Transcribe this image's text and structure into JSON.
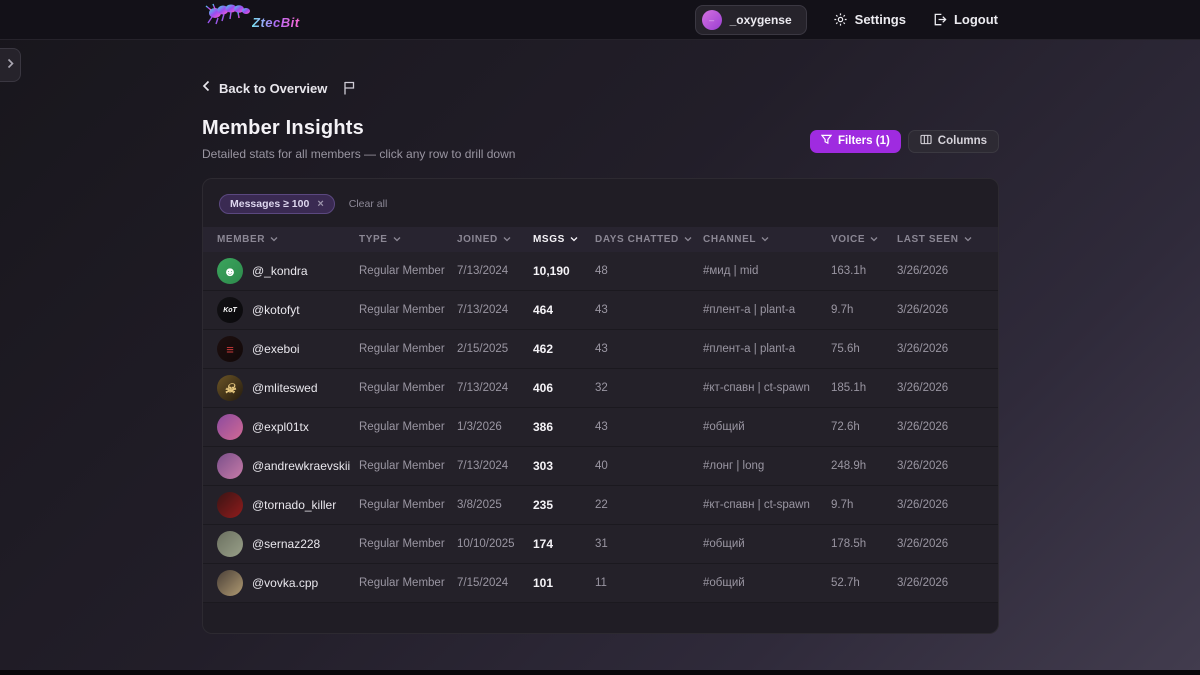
{
  "brand": {
    "name": "ZtecBit"
  },
  "topbar": {
    "username": "_oxygense",
    "user_avatar_mark": "–",
    "settings_label": "Settings",
    "logout_label": "Logout"
  },
  "page": {
    "back_label": "Back to Overview",
    "title": "Member Insights",
    "subtitle": "Detailed stats for all members — click any row to drill down",
    "filters_label": "Filters (1)",
    "columns_label": "Columns"
  },
  "filters": {
    "chip_label": "Messages ≥ 100",
    "chip_remove": "×",
    "clear_label": "Clear all"
  },
  "colors": {
    "accent_purple": "#9f2be0",
    "chip_bg": "#3a2a52",
    "card_bg": "#201d25",
    "topbar_bg": "#131118"
  },
  "table": {
    "columns": [
      {
        "label": "MEMBER",
        "active": false
      },
      {
        "label": "TYPE",
        "active": false
      },
      {
        "label": "JOINED",
        "active": false
      },
      {
        "label": "MSGS",
        "active": true
      },
      {
        "label": "DAYS CHATTED",
        "active": false
      },
      {
        "label": "CHANNEL",
        "active": false
      },
      {
        "label": "VOICE",
        "active": false
      },
      {
        "label": "LAST SEEN",
        "active": false
      }
    ],
    "rows": [
      {
        "member": "@_kondra",
        "type": "Regular Member",
        "joined": "7/13/2024",
        "msgs": "10,190",
        "days": "48",
        "channel": "#мид | mid",
        "voice": "163.1h",
        "last_seen": "3/26/2026",
        "avatar": {
          "glyph": "☻",
          "glyph_color": "#ffffff",
          "from": "#3ba55d",
          "to": "#2e8a4c"
        }
      },
      {
        "member": "@kotofyt",
        "type": "Regular Member",
        "joined": "7/13/2024",
        "msgs": "464",
        "days": "43",
        "channel": "#плент-а | plant-a",
        "voice": "9.7h",
        "last_seen": "3/26/2026",
        "avatar": {
          "glyph": "KoT",
          "glyph_color": "#ffffff",
          "from": "#121114",
          "to": "#0a090c"
        }
      },
      {
        "member": "@exeboi",
        "type": "Regular Member",
        "joined": "2/15/2025",
        "msgs": "462",
        "days": "43",
        "channel": "#плент-а | plant-a",
        "voice": "75.6h",
        "last_seen": "3/26/2026",
        "avatar": {
          "glyph": "≡",
          "glyph_color": "#c93a3a",
          "from": "#1d0f0f",
          "to": "#120909"
        }
      },
      {
        "member": "@mliteswed",
        "type": "Regular Member",
        "joined": "7/13/2024",
        "msgs": "406",
        "days": "32",
        "channel": "#кт-спавн | ct-spawn",
        "voice": "185.1h",
        "last_seen": "3/26/2026",
        "avatar": {
          "glyph": "☠",
          "glyph_color": "#e6c77e",
          "from": "#6b5426",
          "to": "#241b0e"
        }
      },
      {
        "member": "@expl01tx",
        "type": "Regular Member",
        "joined": "1/3/2026",
        "msgs": "386",
        "days": "43",
        "channel": "#общий",
        "voice": "72.6h",
        "last_seen": "3/26/2026",
        "avatar": {
          "glyph": "",
          "glyph_color": "#ffffff",
          "from": "#8b4a9e",
          "to": "#d16a95"
        }
      },
      {
        "member": "@andrewkraevskii",
        "type": "Regular Member",
        "joined": "7/13/2024",
        "msgs": "303",
        "days": "40",
        "channel": "#лонг | long",
        "voice": "248.9h",
        "last_seen": "3/26/2026",
        "avatar": {
          "glyph": "",
          "glyph_color": "#ffffff",
          "from": "#7a4f8a",
          "to": "#c77ba8"
        }
      },
      {
        "member": "@tornado_killer",
        "type": "Regular Member",
        "joined": "3/8/2025",
        "msgs": "235",
        "days": "22",
        "channel": "#кт-спавн | ct-spawn",
        "voice": "9.7h",
        "last_seen": "3/26/2026",
        "avatar": {
          "glyph": "",
          "glyph_color": "#ffffff",
          "from": "#3a1414",
          "to": "#911c1c"
        }
      },
      {
        "member": "@sernaz228",
        "type": "Regular Member",
        "joined": "10/10/2025",
        "msgs": "174",
        "days": "31",
        "channel": "#общий",
        "voice": "178.5h",
        "last_seen": "3/26/2026",
        "avatar": {
          "glyph": "",
          "glyph_color": "#ffffff",
          "from": "#6b7060",
          "to": "#99a089"
        }
      },
      {
        "member": "@vovka.cpp",
        "type": "Regular Member",
        "joined": "7/15/2024",
        "msgs": "101",
        "days": "11",
        "channel": "#общий",
        "voice": "52.7h",
        "last_seen": "3/26/2026",
        "avatar": {
          "glyph": "",
          "glyph_color": "#ffffff",
          "from": "#4a4038",
          "to": "#b09a72"
        }
      }
    ]
  }
}
